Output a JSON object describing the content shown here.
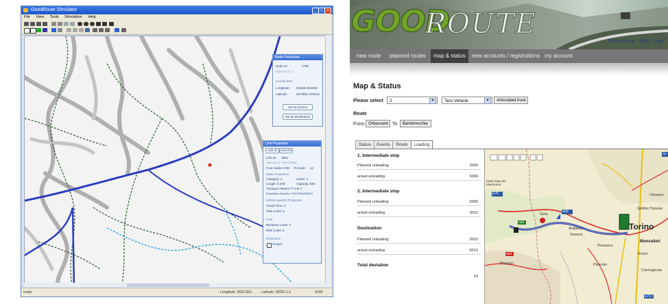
{
  "left_window": {
    "title": "GoodRoute Simulator",
    "menu": [
      "File",
      "View",
      "Tools",
      "Simulation",
      "Help"
    ],
    "status": {
      "left": "ready",
      "longitude": "Longitude: 6622.6E2",
      "latitude": "Latitude: 28392.1-2",
      "right": "NUM"
    },
    "node_properties": {
      "title": "Node Properties",
      "node_id_label": "Node ID:",
      "node_id": "1786",
      "node_sub": "Internal ID: 4",
      "coordinates_label": "Coordinates",
      "longitude_label": "Longitude:",
      "longitude": "561196.812842",
      "latitude_label": "Latitude:",
      "latitude": "2073991.376213",
      "set_source": "Set as Source",
      "set_destination": "Set as Destination"
    },
    "link_properties": {
      "title": "Link Properties",
      "tabs": [
        "Link ID",
        "Link (%)"
      ],
      "link_id_label": "Link ID:",
      "link_id": "3084",
      "internal_id": "Internal ID: 5084/3084",
      "from_node_label": "From Node:",
      "from_node": "1790",
      "to_node_label": "To Node:",
      "to_node": "44",
      "static_props_label": "Static Properties",
      "category_label": "Category: 4",
      "lanes_label": "Lanes: 1",
      "length_label": "Length: 0.405",
      "capacity_label": "Capacity: 600",
      "transport_label": "Transport Means: F-C-B-T",
      "population_label": "Population Density: 0.0022436493204",
      "vehicle_props_label": "Vehicle specific Properties",
      "travel_time_label": "Travel Time: 0",
      "toll_costs_label": "Tolls Costs: 0",
      "cost_label": "Cost",
      "business_cost_label": "Business Costs: 0",
      "risk_cost_label": "Risk Costs: 0",
      "restriction_label": "Restriction",
      "closed_label": "Closed"
    }
  },
  "right_page": {
    "logo_good": "GOOD",
    "logo_route": "ROUTE",
    "top_links": [
      "Terms of use",
      "Help",
      "Logo"
    ],
    "nav": [
      "new route",
      "planned routes",
      "map & status",
      "new accounts / registrations",
      "my account"
    ],
    "active_nav": "map & status",
    "title": "Map & Status",
    "please_select_label": "Please select",
    "select_value": "2",
    "vehicle_value": "Test Vehicle",
    "vehicle_type": "Articulated truck",
    "route_label": "Route",
    "from_label": "From",
    "from_value": "Orbassano",
    "to_label": "To",
    "to_value": "Bardonecchia",
    "tabs": [
      "Status",
      "Events",
      "Route",
      "Loading"
    ],
    "active_tab": "Loading",
    "sections": [
      {
        "title": "1. Intermediate stop",
        "rows": [
          {
            "label": "Planned unloading",
            "value": "5000"
          },
          {
            "label": "actual unloading",
            "value": "5006"
          }
        ]
      },
      {
        "title": "2. Intermediate stop",
        "rows": [
          {
            "label": "Planned unloading",
            "value": "5000"
          },
          {
            "label": "actual unloading",
            "value": "5011"
          }
        ]
      },
      {
        "title": "Destination",
        "rows": [
          {
            "label": "Planned unloading",
            "value": "5013"
          },
          {
            "label": "actual unloading",
            "value": "5013"
          }
        ]
      },
      {
        "title": "Total deviation",
        "rows": [
          {
            "label": "",
            "value": "19"
          }
        ]
      }
    ],
    "map_labels": {
      "torino": "Torino",
      "avigliana": "Avigliana",
      "giaveno": "Giaveno",
      "piossasco": "Piossasco",
      "moncalieri": "Moncalieri",
      "pinerolo": "Pinerolo",
      "carmagnola": "Carmagnola",
      "briancon": "Briançon",
      "susa": "Susa",
      "vinovo": "Vinovo",
      "chivasso": "Chivasso",
      "settimo": "Settimo Torinese",
      "saint_jean": "Saint-Jean-de-Maurienne",
      "a32": "A32",
      "a55": "A55",
      "e70": "E70",
      "n94": "N94",
      "e717": "E717",
      "a5": "A5"
    }
  }
}
